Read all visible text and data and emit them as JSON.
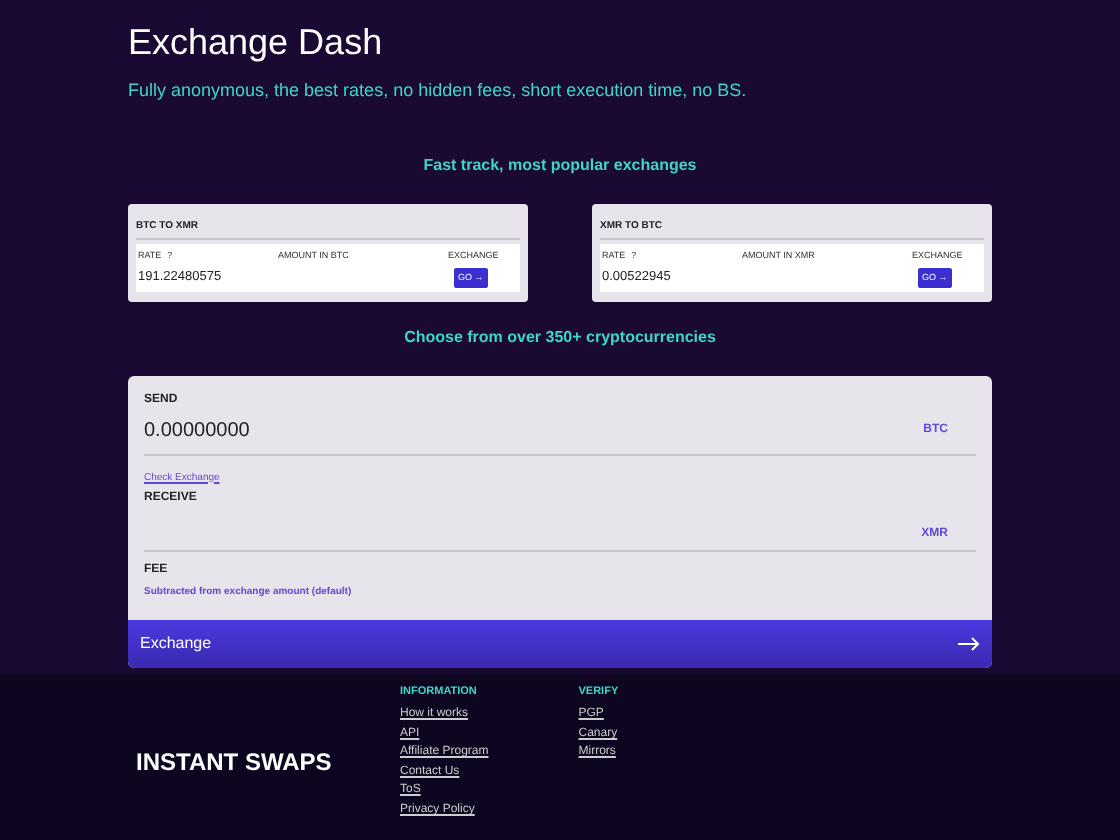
{
  "header": {
    "title": "Exchange Dash",
    "subtitle": "Fully anonymous, the best rates, no hidden fees, short execution time, no BS."
  },
  "fast_track": {
    "heading": "Fast track, most popular exchanges",
    "cards": [
      {
        "title": "BTC TO XMR",
        "rate_label": "RATE",
        "help": "?",
        "amount_label": "AMOUNT IN BTC",
        "exchange_label": "EXCHANGE",
        "rate": "191.22480575",
        "button": "GO →"
      },
      {
        "title": "XMR TO BTC",
        "rate_label": "RATE",
        "help": "?",
        "amount_label": "AMOUNT IN XMR",
        "exchange_label": "EXCHANGE",
        "rate": "0.00522945",
        "button": "GO →"
      }
    ]
  },
  "choose_heading": "Choose from over 350+ cryptocurrencies",
  "form": {
    "send_label": "SEND",
    "send_value": "0.00000000",
    "send_currency": "BTC",
    "check_link": "Check Exchange",
    "receive_label": "RECEIVE",
    "receive_currency": "XMR",
    "fee_label": "FEE",
    "fee_note": "Subtracted from exchange amount (default)",
    "button": "Exchange"
  },
  "footer": {
    "brand": "INSTANT SWAPS",
    "columns": [
      {
        "heading": "INFORMATION",
        "links": [
          "How it works",
          "API",
          "Affiliate Program",
          "Contact Us",
          "ToS",
          "Privacy Policy"
        ]
      },
      {
        "heading": "VERIFY",
        "links": [
          "PGP",
          "Canary",
          "Mirrors"
        ]
      }
    ]
  }
}
